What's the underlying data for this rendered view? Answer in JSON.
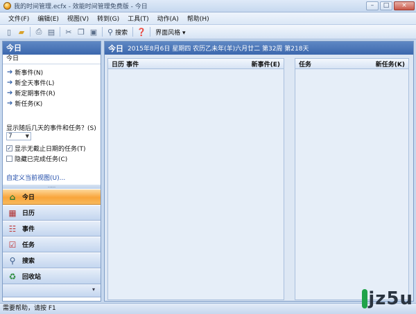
{
  "window": {
    "title": "我的时间管理.ecfx - 效能时间管理免费版 - 今日",
    "buttons": {
      "minimize": "–",
      "maximize": "□",
      "close": "×"
    }
  },
  "menu": [
    "文件(F)",
    "编辑(E)",
    "视图(V)",
    "转到(G)",
    "工具(T)",
    "动作(A)",
    "帮助(H)"
  ],
  "toolbar": {
    "search_label": "搜索",
    "style_label": "界面风格 ▾"
  },
  "left": {
    "header": "今日",
    "section_title": "今日",
    "new_items": [
      "新事件(N)",
      "新全天事件(L)",
      "新定期事件(R)",
      "新任务(K)"
    ],
    "days_question": "显示随后几天的事件和任务？(S)",
    "days_value": "7",
    "show_no_deadline": "显示无截止日期的任务(T)",
    "hide_done": "隐藏已完成任务(C)",
    "customize_link": "自定义当前视图(U)...",
    "splitter": "....."
  },
  "nav": [
    {
      "label": "今日",
      "icon": "home-icon"
    },
    {
      "label": "日历",
      "icon": "calendar-icon"
    },
    {
      "label": "事件",
      "icon": "event-icon"
    },
    {
      "label": "任务",
      "icon": "task-icon"
    },
    {
      "label": "搜索",
      "icon": "search-icon"
    },
    {
      "label": "回收站",
      "icon": "recycle-icon"
    }
  ],
  "right": {
    "header_big": "今日",
    "header_date": "2015年8月6日 星期四 农历乙未年(羊)六月廿二 第32周 第218天",
    "calendar_col": {
      "title": "日历 事件",
      "action": "新事件(E)"
    },
    "task_col": {
      "title": "任务",
      "action": "新任务(K)"
    }
  },
  "status": {
    "text": "需要帮助，请按 F1"
  },
  "watermark": {
    "text": "jz5u"
  },
  "colors": {
    "header_blue": "#3b67ad",
    "active_orange": "#f9a53a",
    "link_blue": "#1c49a8"
  }
}
